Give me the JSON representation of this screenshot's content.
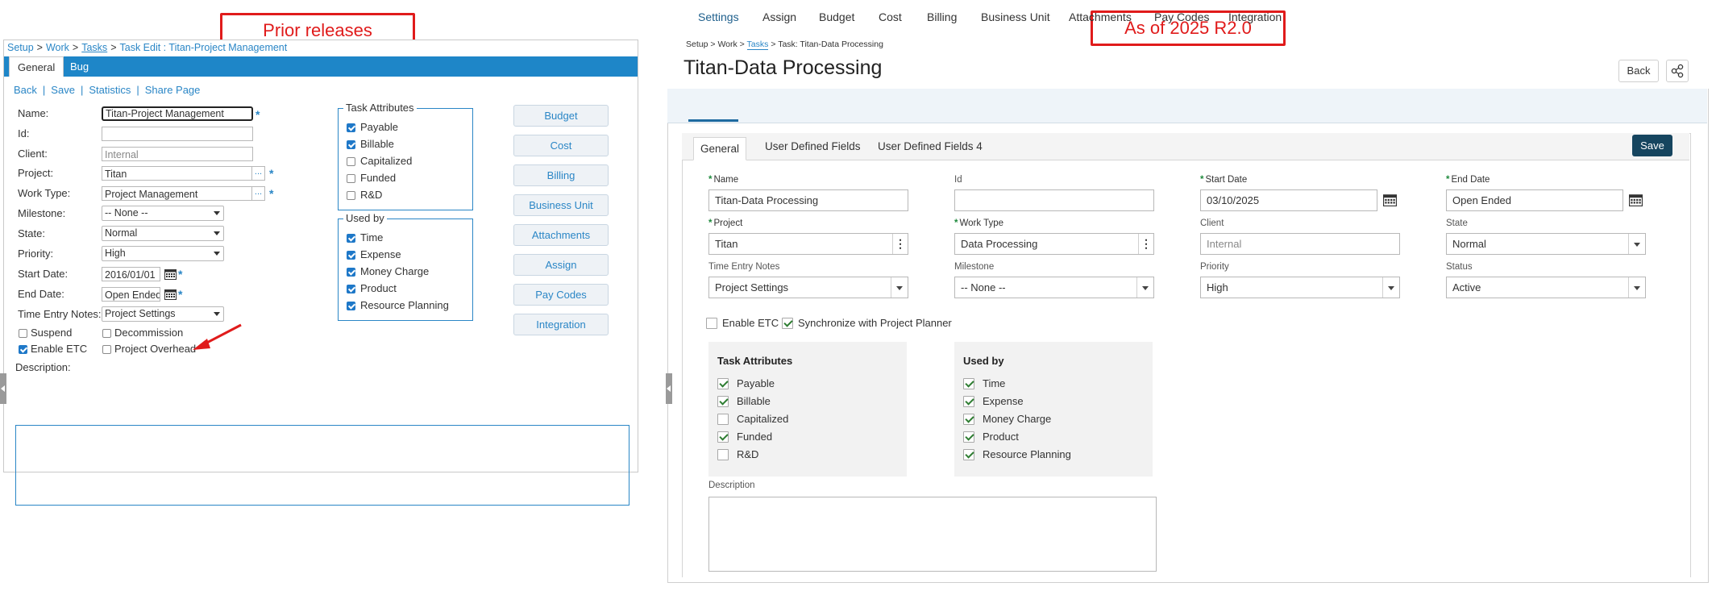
{
  "callouts": {
    "left": "Prior releases",
    "right": "As of 2025 R2.0"
  },
  "old": {
    "breadcrumb": {
      "setup": "Setup",
      "work": "Work",
      "tasks": "Tasks",
      "tail": "Task Edit : Titan-Project Management",
      "sep": ">"
    },
    "tabs": {
      "general": "General",
      "bug": "Bug"
    },
    "actions": {
      "back": "Back",
      "save": "Save",
      "statistics": "Statistics",
      "share": "Share Page",
      "sep": "|"
    },
    "fields": {
      "name_label": "Name:",
      "name_value": "Titan-Project Management",
      "id_label": "Id:",
      "id_value": "",
      "client_label": "Client:",
      "client_value": "Internal",
      "project_label": "Project:",
      "project_value": "Titan",
      "work_type_label": "Work Type:",
      "work_type_value": "Project Management",
      "milestone_label": "Milestone:",
      "milestone_value": "-- None --",
      "state_label": "State:",
      "state_value": "Normal",
      "priority_label": "Priority:",
      "priority_value": "High",
      "start_label": "Start Date:",
      "start_value": "2016/01/01",
      "end_label": "End Date:",
      "end_value": "Open Ended",
      "ten_label": "Time Entry Notes:",
      "ten_value": "Project Settings",
      "dots": "...",
      "star": "*"
    },
    "checks": {
      "suspend": "Suspend",
      "decommission": "Decommission",
      "enable_etc": "Enable ETC",
      "project_overhead": "Project Overhead"
    },
    "description_label": "Description:",
    "task_attributes": {
      "legend": "Task Attributes",
      "items": [
        {
          "label": "Payable",
          "checked": true
        },
        {
          "label": "Billable",
          "checked": true
        },
        {
          "label": "Capitalized",
          "checked": false
        },
        {
          "label": "Funded",
          "checked": false
        },
        {
          "label": "R&D",
          "checked": false
        }
      ]
    },
    "used_by": {
      "legend": "Used by",
      "items": [
        {
          "label": "Time",
          "checked": true
        },
        {
          "label": "Expense",
          "checked": true
        },
        {
          "label": "Money Charge",
          "checked": true
        },
        {
          "label": "Product",
          "checked": true
        },
        {
          "label": "Resource Planning",
          "checked": true
        }
      ]
    },
    "side_buttons": [
      "Budget",
      "Cost",
      "Billing",
      "Business Unit",
      "Attachments",
      "Assign",
      "Pay Codes",
      "Integration"
    ]
  },
  "new": {
    "breadcrumb": {
      "setup": "Setup",
      "work": "Work",
      "tasks": "Tasks",
      "tail": "Task: Titan-Data Processing",
      "sep": ">"
    },
    "title": "Titan-Data Processing",
    "back": "Back",
    "tabs": [
      "Settings",
      "Assign",
      "Budget",
      "Cost",
      "Billing",
      "Business Unit",
      "Attachments",
      "Pay Codes",
      "Integration"
    ],
    "inner_tabs": [
      "General",
      "User Defined Fields",
      "User Defined Fields 4"
    ],
    "save": "Save",
    "req": "*",
    "fields": {
      "name_label": "Name",
      "name_value": "Titan-Data Processing",
      "id_label": "Id",
      "id_value": "",
      "start_label": "Start Date",
      "start_value": "03/10/2025",
      "end_label": "End Date",
      "end_value": "Open Ended",
      "project_label": "Project",
      "project_value": "Titan",
      "work_type_label": "Work Type",
      "work_type_value": "Data Processing",
      "client_label": "Client",
      "client_value": "Internal",
      "state_label": "State",
      "state_value": "Normal",
      "ten_label": "Time Entry Notes",
      "ten_value": "Project Settings",
      "milestone_label": "Milestone",
      "milestone_value": "-- None --",
      "priority_label": "Priority",
      "priority_value": "High",
      "status_label": "Status",
      "status_value": "Active"
    },
    "checks": {
      "enable_etc": "Enable ETC",
      "sync_planner": "Synchronize with Project Planner"
    },
    "task_attributes": {
      "title": "Task Attributes",
      "items": [
        {
          "label": "Payable",
          "checked": true
        },
        {
          "label": "Billable",
          "checked": true
        },
        {
          "label": "Capitalized",
          "checked": false
        },
        {
          "label": "Funded",
          "checked": true
        },
        {
          "label": "R&D",
          "checked": false
        }
      ]
    },
    "used_by": {
      "title": "Used by",
      "items": [
        {
          "label": "Time",
          "checked": true
        },
        {
          "label": "Expense",
          "checked": true
        },
        {
          "label": "Money Charge",
          "checked": true
        },
        {
          "label": "Product",
          "checked": true
        },
        {
          "label": "Resource Planning",
          "checked": true
        }
      ]
    },
    "description_label": "Description"
  },
  "colors": {
    "accent": "#1e86c8",
    "callout": "#e01b1b",
    "save_button": "#16455f"
  }
}
